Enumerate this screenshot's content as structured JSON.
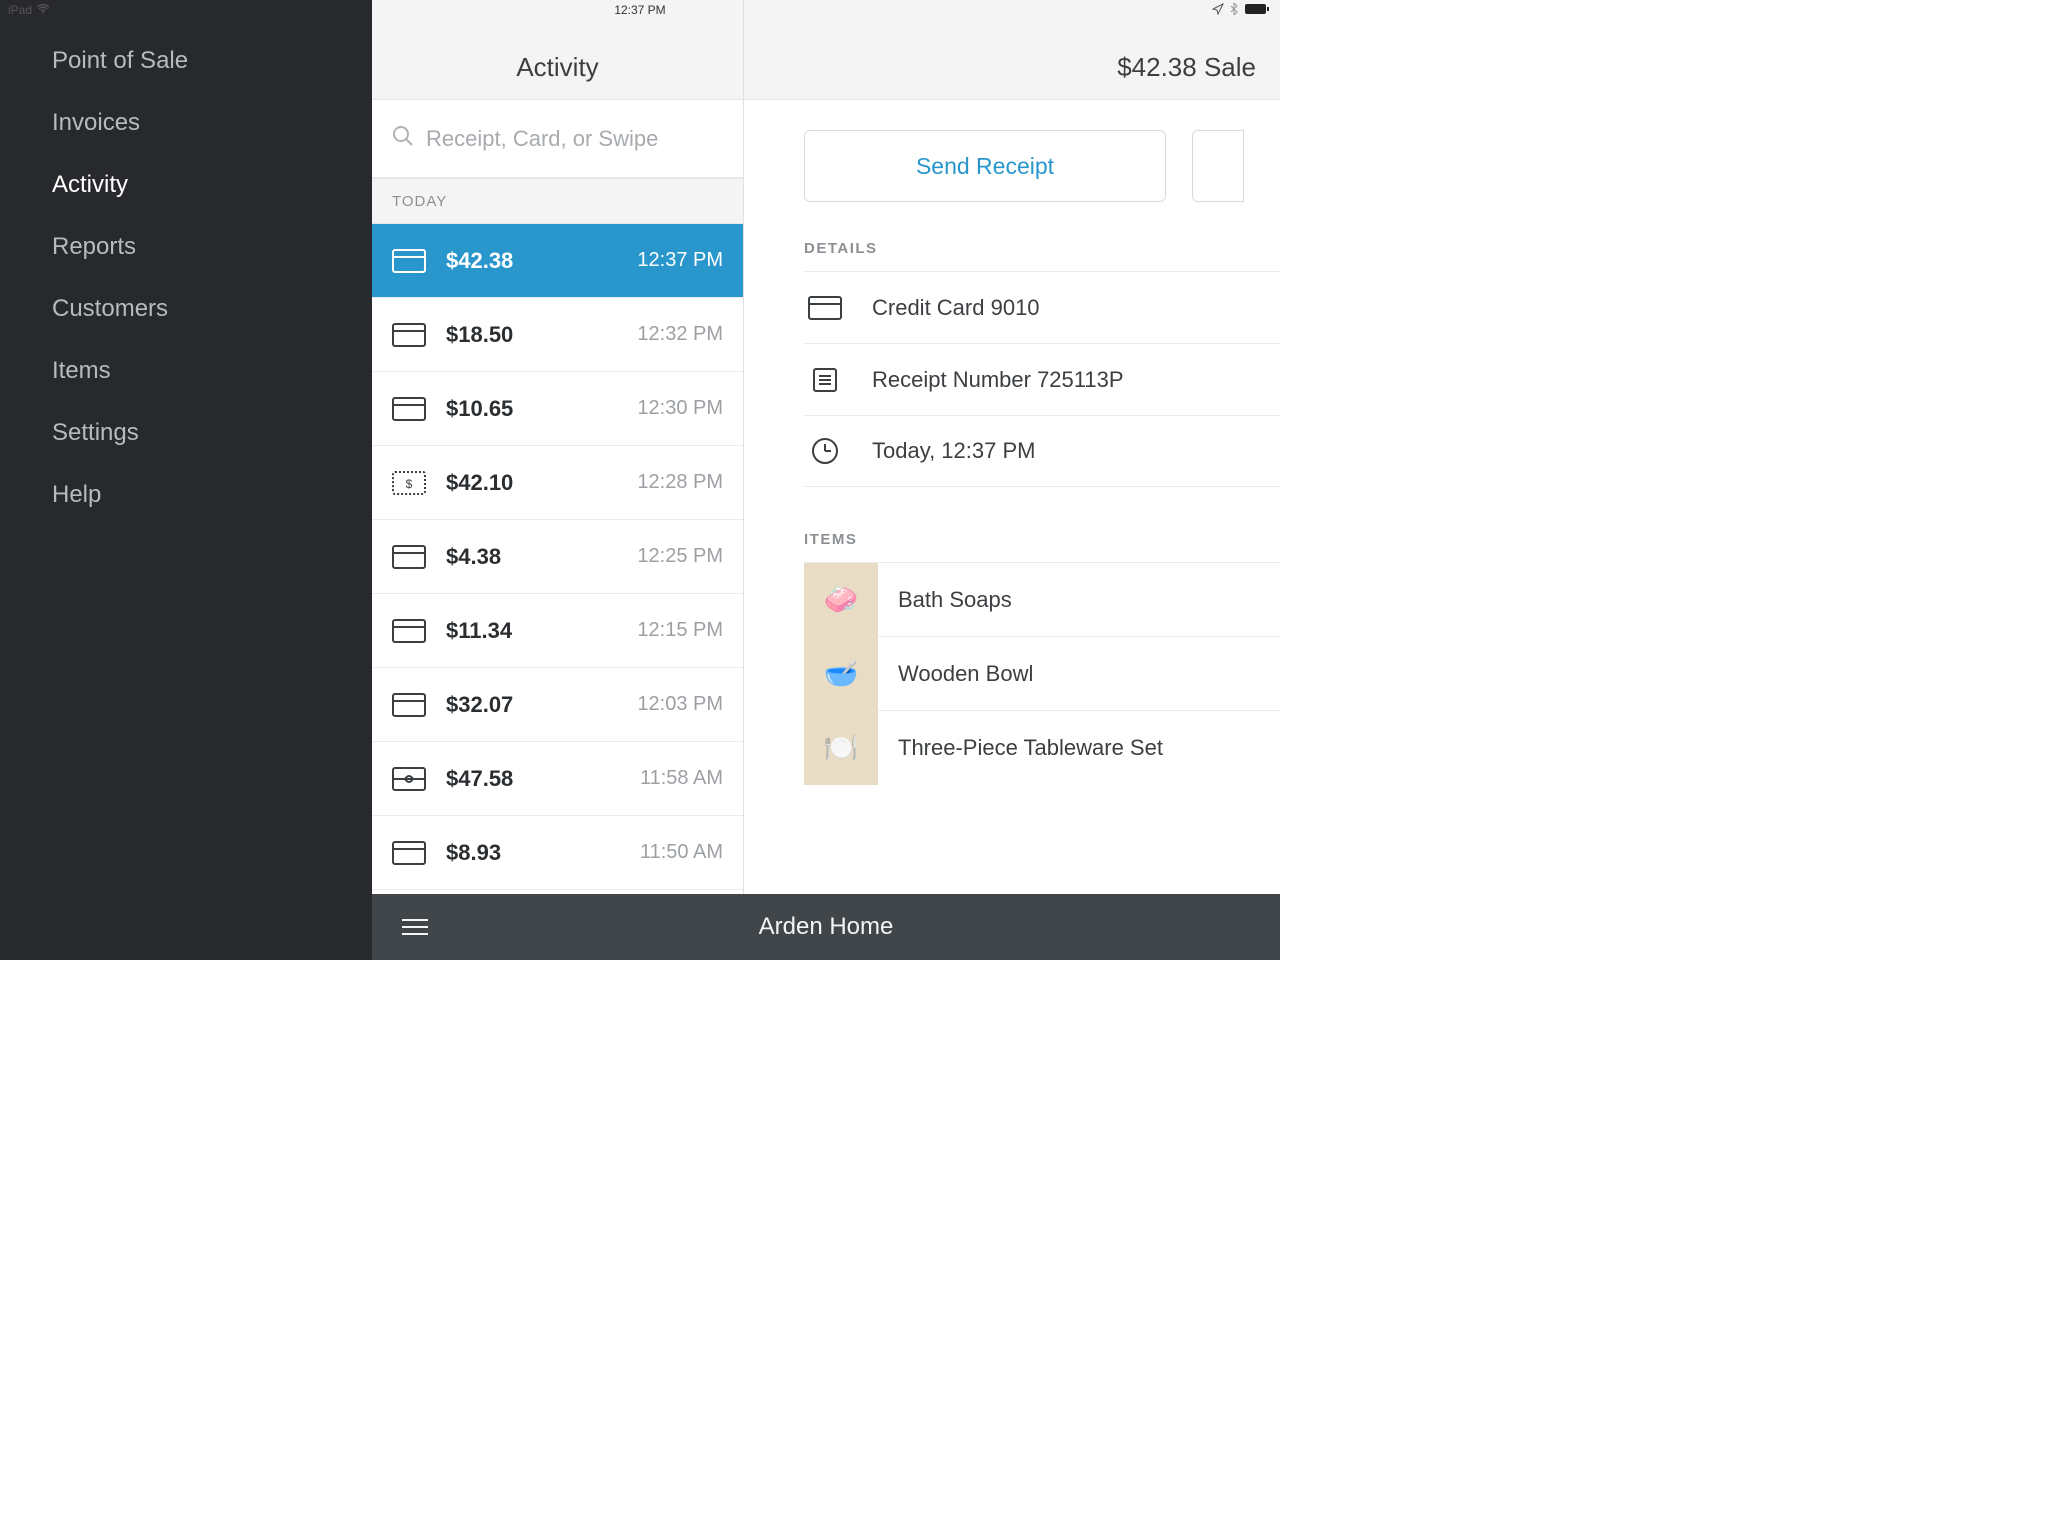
{
  "status": {
    "device": "iPad",
    "time": "12:37 PM"
  },
  "sidebar": {
    "items": [
      {
        "label": "Point of Sale"
      },
      {
        "label": "Invoices"
      },
      {
        "label": "Activity",
        "active": true
      },
      {
        "label": "Reports"
      },
      {
        "label": "Customers"
      },
      {
        "label": "Items"
      },
      {
        "label": "Settings"
      },
      {
        "label": "Help"
      }
    ]
  },
  "activity": {
    "title": "Activity",
    "search_placeholder": "Receipt, Card, or Swipe",
    "section": "TODAY",
    "transactions": [
      {
        "amount": "$42.38",
        "time": "12:37 PM",
        "icon": "card",
        "selected": true
      },
      {
        "amount": "$18.50",
        "time": "12:32 PM",
        "icon": "card"
      },
      {
        "amount": "$10.65",
        "time": "12:30 PM",
        "icon": "card"
      },
      {
        "amount": "$42.10",
        "time": "12:28 PM",
        "icon": "cash"
      },
      {
        "amount": "$4.38",
        "time": "12:25 PM",
        "icon": "card"
      },
      {
        "amount": "$11.34",
        "time": "12:15 PM",
        "icon": "card"
      },
      {
        "amount": "$32.07",
        "time": "12:03 PM",
        "icon": "card"
      },
      {
        "amount": "$47.58",
        "time": "11:58 AM",
        "icon": "gift"
      },
      {
        "amount": "$8.93",
        "time": "11:50 AM",
        "icon": "card"
      }
    ]
  },
  "sale": {
    "header": "$42.38 Sale",
    "send_receipt_label": "Send Receipt",
    "details_title": "DETAILS",
    "details": [
      {
        "icon": "card",
        "text": "Credit Card 9010"
      },
      {
        "icon": "receipt",
        "text": "Receipt Number 725113P"
      },
      {
        "icon": "clock",
        "text": "Today, 12:37 PM"
      }
    ],
    "items_title": "ITEMS",
    "items": [
      {
        "name": "Bath Soaps",
        "emoji": "🧼"
      },
      {
        "name": "Wooden Bowl",
        "emoji": "🥣"
      },
      {
        "name": "Three-Piece Tableware Set",
        "emoji": "🍽️"
      }
    ]
  },
  "bottom": {
    "title": "Arden Home"
  }
}
